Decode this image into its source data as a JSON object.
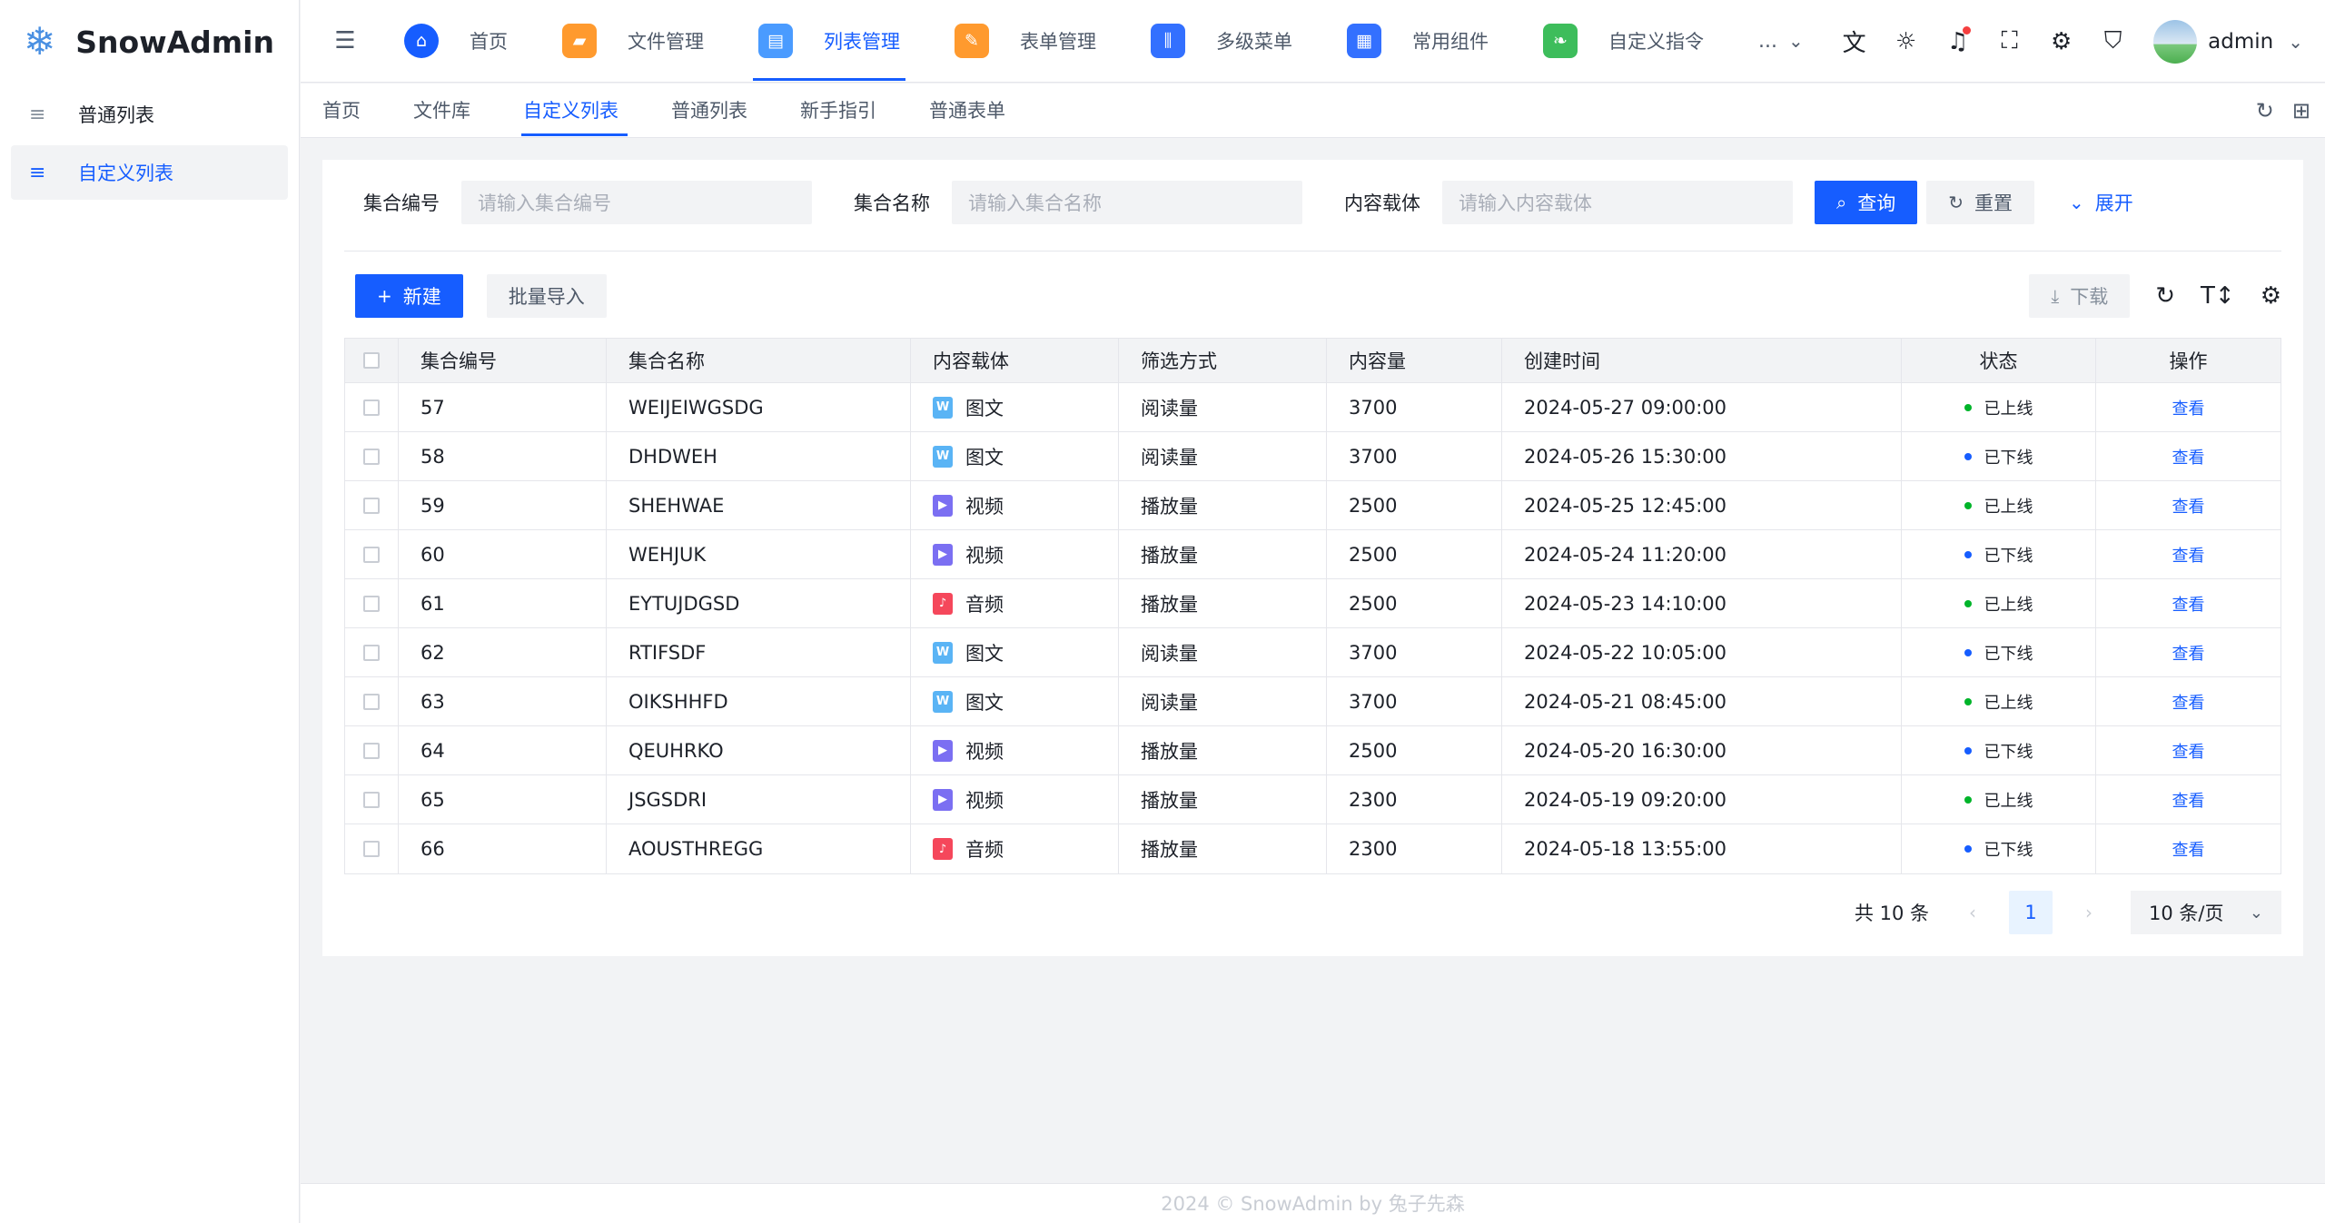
{
  "app": {
    "name": "SnowAdmin",
    "logo_icon": "snowflake-icon",
    "accent": "#165dff"
  },
  "sidebar": {
    "items": [
      {
        "label": "普通列表",
        "icon": "list-icon",
        "active": false
      },
      {
        "label": "自定义列表",
        "icon": "list-icon",
        "active": true
      }
    ]
  },
  "topnav": {
    "items": [
      {
        "label": "首页",
        "icon": "home-icon",
        "color": "#165dff"
      },
      {
        "label": "文件管理",
        "icon": "folder-icon",
        "color": "#ff9a2e"
      },
      {
        "label": "列表管理",
        "icon": "clipboard-icon",
        "color": "#4a9bff",
        "active": true
      },
      {
        "label": "表单管理",
        "icon": "form-icon",
        "color": "#ff9a2e"
      },
      {
        "label": "多级菜单",
        "icon": "sliders-icon",
        "color": "#3370ff"
      },
      {
        "label": "常用组件",
        "icon": "grid-icon",
        "color": "#3370ff"
      },
      {
        "label": "自定义指令",
        "icon": "leaf-icon",
        "color": "#3dbd5b"
      }
    ],
    "more_label": "...",
    "user": "admin"
  },
  "tabs": [
    "首页",
    "文件库",
    "自定义列表",
    "普通列表",
    "新手指引",
    "普通表单"
  ],
  "active_tab": 2,
  "search": {
    "fields": [
      {
        "label": "集合编号",
        "placeholder": "请输入集合编号"
      },
      {
        "label": "集合名称",
        "placeholder": "请输入集合名称"
      },
      {
        "label": "内容载体",
        "placeholder": "请输入内容载体"
      }
    ],
    "query_label": "查询",
    "reset_label": "重置",
    "expand_label": "展开"
  },
  "actions": {
    "new_label": "新建",
    "import_label": "批量导入",
    "download_label": "下载"
  },
  "table": {
    "headers": [
      "集合编号",
      "集合名称",
      "内容载体",
      "筛选方式",
      "内容量",
      "创建时间",
      "状态",
      "操作"
    ],
    "rows": [
      {
        "id": "57",
        "name": "WEIJEIWGSDG",
        "carrier": "图文",
        "ctype": "doc",
        "filter": "阅读量",
        "volume": "3700",
        "time": "2024-05-27 09:00:00",
        "status": "已上线",
        "online": true,
        "op": "查看"
      },
      {
        "id": "58",
        "name": "DHDWEH",
        "carrier": "图文",
        "ctype": "doc",
        "filter": "阅读量",
        "volume": "3700",
        "time": "2024-05-26 15:30:00",
        "status": "已下线",
        "online": false,
        "op": "查看"
      },
      {
        "id": "59",
        "name": "SHEHWAE",
        "carrier": "视频",
        "ctype": "video",
        "filter": "播放量",
        "volume": "2500",
        "time": "2024-05-25 12:45:00",
        "status": "已上线",
        "online": true,
        "op": "查看"
      },
      {
        "id": "60",
        "name": "WEHJUK",
        "carrier": "视频",
        "ctype": "video",
        "filter": "播放量",
        "volume": "2500",
        "time": "2024-05-24 11:20:00",
        "status": "已下线",
        "online": false,
        "op": "查看"
      },
      {
        "id": "61",
        "name": "EYTUJDGSD",
        "carrier": "音频",
        "ctype": "audio",
        "filter": "播放量",
        "volume": "2500",
        "time": "2024-05-23 14:10:00",
        "status": "已上线",
        "online": true,
        "op": "查看"
      },
      {
        "id": "62",
        "name": "RTIFSDF",
        "carrier": "图文",
        "ctype": "doc",
        "filter": "阅读量",
        "volume": "3700",
        "time": "2024-05-22 10:05:00",
        "status": "已下线",
        "online": false,
        "op": "查看"
      },
      {
        "id": "63",
        "name": "OIKSHHFD",
        "carrier": "图文",
        "ctype": "doc",
        "filter": "阅读量",
        "volume": "3700",
        "time": "2024-05-21 08:45:00",
        "status": "已上线",
        "online": true,
        "op": "查看"
      },
      {
        "id": "64",
        "name": "QEUHRKO",
        "carrier": "视频",
        "ctype": "video",
        "filter": "播放量",
        "volume": "2500",
        "time": "2024-05-20 16:30:00",
        "status": "已下线",
        "online": false,
        "op": "查看"
      },
      {
        "id": "65",
        "name": "JSGSDRI",
        "carrier": "视频",
        "ctype": "video",
        "filter": "播放量",
        "volume": "2300",
        "time": "2024-05-19 09:20:00",
        "status": "已上线",
        "online": true,
        "op": "查看"
      },
      {
        "id": "66",
        "name": "AOUSTHREGG",
        "carrier": "音频",
        "ctype": "audio",
        "filter": "播放量",
        "volume": "2300",
        "time": "2024-05-18 13:55:00",
        "status": "已下线",
        "online": false,
        "op": "查看"
      }
    ]
  },
  "colors": {
    "online": "#00b42a",
    "offline": "#165dff",
    "doc": "#5ab4f5",
    "video": "#7b6ff2",
    "audio": "#f5475b"
  },
  "pagination": {
    "total_label": "共 10 条",
    "current_page": "1",
    "page_size_label": "10 条/页"
  },
  "footer": "2024 © SnowAdmin by 兔子先森"
}
